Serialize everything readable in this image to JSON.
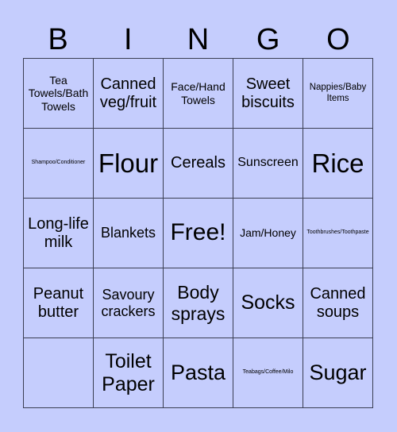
{
  "header": {
    "letters": [
      "B",
      "I",
      "N",
      "G",
      "O"
    ]
  },
  "board": {
    "rows": [
      [
        "Tea Towels/Bath Towels",
        "Canned veg/fruit",
        "Face/Hand Towels",
        "Sweet biscuits",
        "Nappies/Baby Items"
      ],
      [
        "Shampoo/Conditioner",
        "Flour",
        "Cereals",
        "Sunscreen",
        "Rice"
      ],
      [
        "Long-life milk",
        "Blankets",
        "Free!",
        "Jam/Honey",
        "Toothbrushes/Toothpaste"
      ],
      [
        "Peanut butter",
        "Savoury crackers",
        "Body sprays",
        "Socks",
        "Canned soups"
      ],
      [
        "",
        "Toilet Paper",
        "Pasta",
        "Teabags/Coffee/Milo",
        "Sugar"
      ]
    ],
    "free_cell": "Free!"
  },
  "colors": {
    "background": "#c5cdfd",
    "grid_line": "#3a3e52",
    "text": "#000000"
  }
}
